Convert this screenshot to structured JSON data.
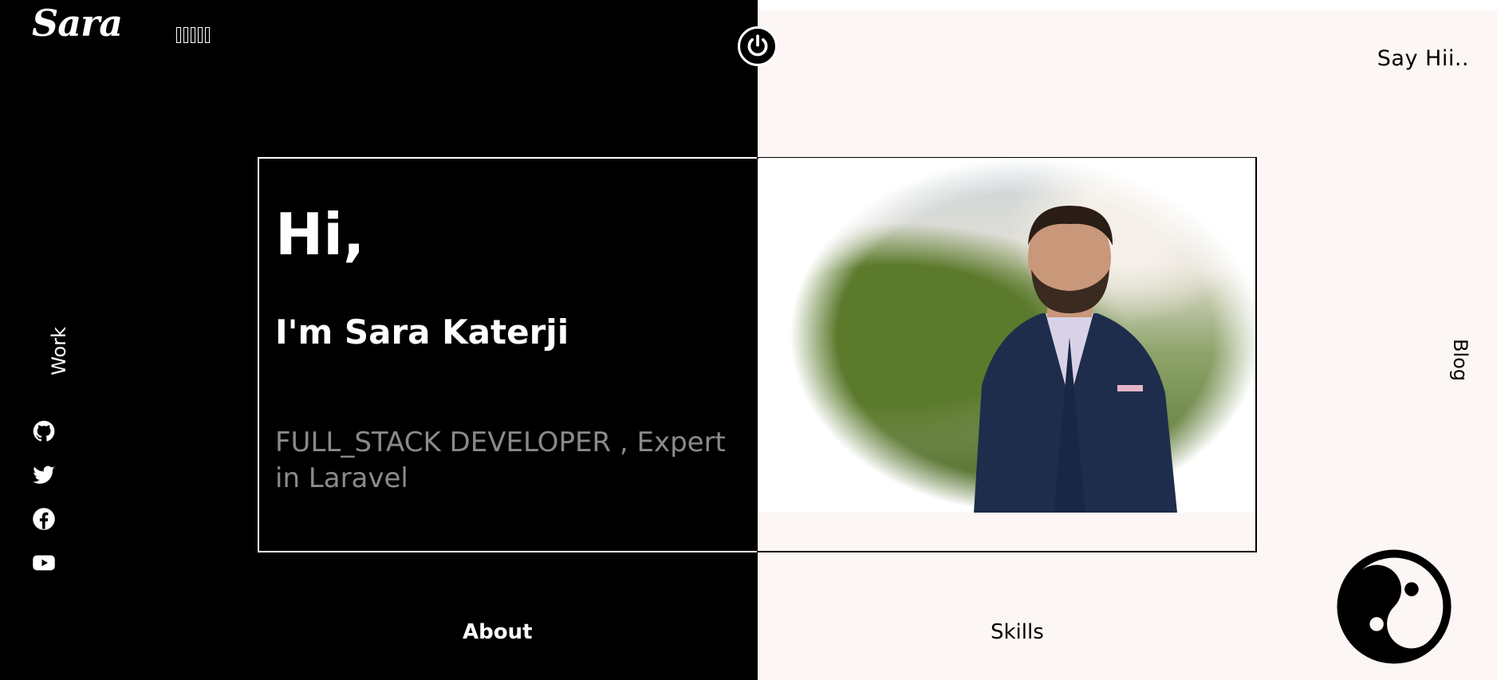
{
  "logo": "Sara",
  "nav": {
    "say_hi": "Say Hii..",
    "work": "Work",
    "blog": "Blog",
    "about": "About",
    "skills": "Skills"
  },
  "hero": {
    "greeting": "Hi,",
    "name": "I'm Sara Katerji",
    "role": "FULL_STACK DEVELOPER , Expert in Laravel"
  },
  "social": [
    "github-icon",
    "twitter-icon",
    "facebook-icon",
    "youtube-icon"
  ],
  "colors": {
    "dark": "#000000",
    "light": "#fcf6f4",
    "muted_text": "#8a8a8a"
  }
}
